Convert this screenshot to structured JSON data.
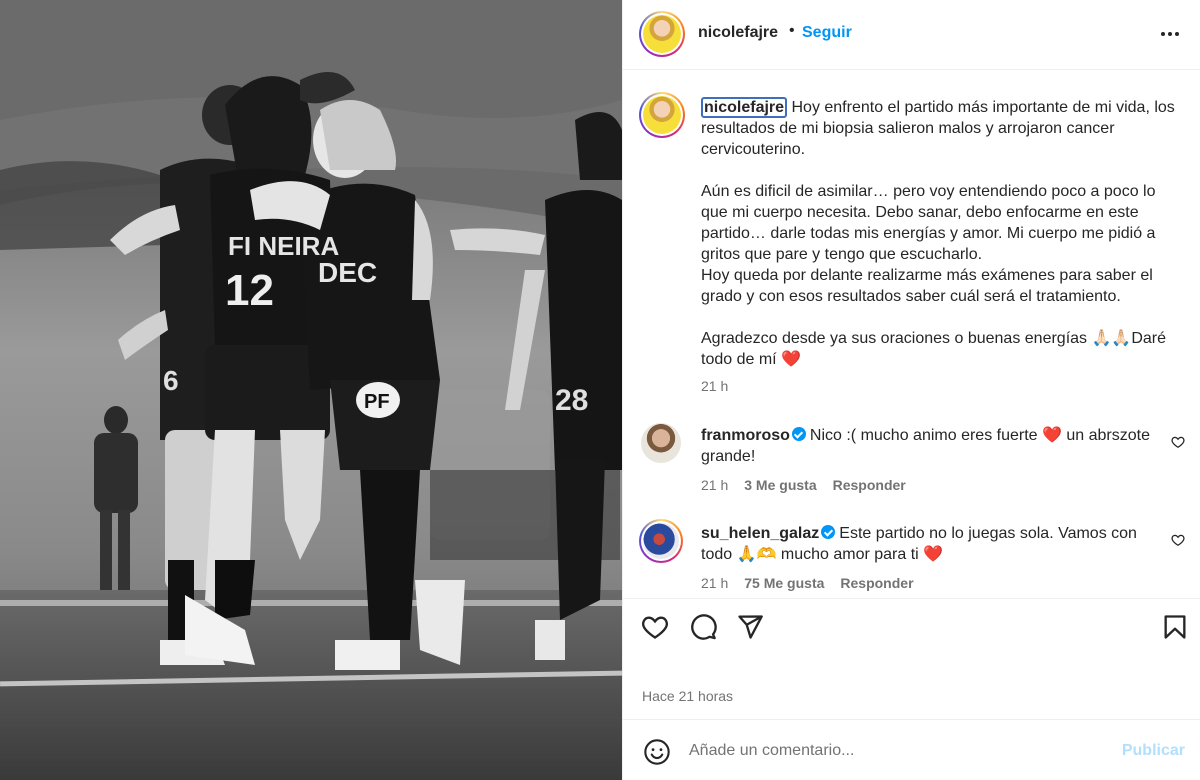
{
  "header": {
    "username": "nicolefajre",
    "separator": "•",
    "follow_label": "Seguir",
    "more_icon": "more-horizontal-icon"
  },
  "caption": {
    "username": "nicolefajre",
    "first_line": "Hoy enfrento el partido más importante de mi vida, los resultados de mi biopsia salieron malos y arrojaron cancer cervicouterino.",
    "paragraph_2a": "Aún es dificil de asimilar… pero voy entendiendo poco a poco lo que mi cuerpo necesita. Debo sanar, debo enfocarme en este partido… darle todas mis energías y amor. Mi cuerpo me pidió a gritos que pare y tengo que escucharlo.",
    "paragraph_2b": "Hoy queda por delante realizarme más exámenes para saber el grado y con esos resultados saber cuál será el tratamiento.",
    "paragraph_3": "Agradezco desde ya sus oraciones o buenas energías 🙏🏻🙏🏻Daré todo de mí ❤️",
    "time": "21 h"
  },
  "comments": [
    {
      "username": "franmoroso",
      "verified": true,
      "text": "Nico :( mucho animo eres fuerte ❤️ un abrszote grande!",
      "time": "21 h",
      "likes": "3 Me gusta",
      "reply_label": "Responder"
    },
    {
      "username": "su_helen_galaz",
      "verified": true,
      "text": "Este partido no lo juegas sola. Vamos con todo 🙏🫶 mucho amor para ti ❤️",
      "time": "21 h",
      "likes": "75 Me gusta",
      "reply_label": "Responder"
    }
  ],
  "actions": {
    "like_icon": "heart-outline-icon",
    "comment_icon": "comment-bubble-icon",
    "share_icon": "paper-plane-icon",
    "save_icon": "bookmark-icon",
    "posted": "Hace 21 horas"
  },
  "add_comment": {
    "placeholder": "Añade un comentario...",
    "publish_label": "Publicar",
    "emoji_icon": "smiley-face-icon"
  },
  "photo": {
    "jersey_name": "FI NEIRA",
    "jersey_number_front": "12",
    "side_text": "DEC",
    "sponsor": "PF",
    "back_number": "28",
    "shorts_number": "6"
  },
  "colors": {
    "link_blue": "#0095f6",
    "publish_disabled": "#b2dffc",
    "verified_blue": "#0095f6",
    "like_red": "#ed4956"
  }
}
